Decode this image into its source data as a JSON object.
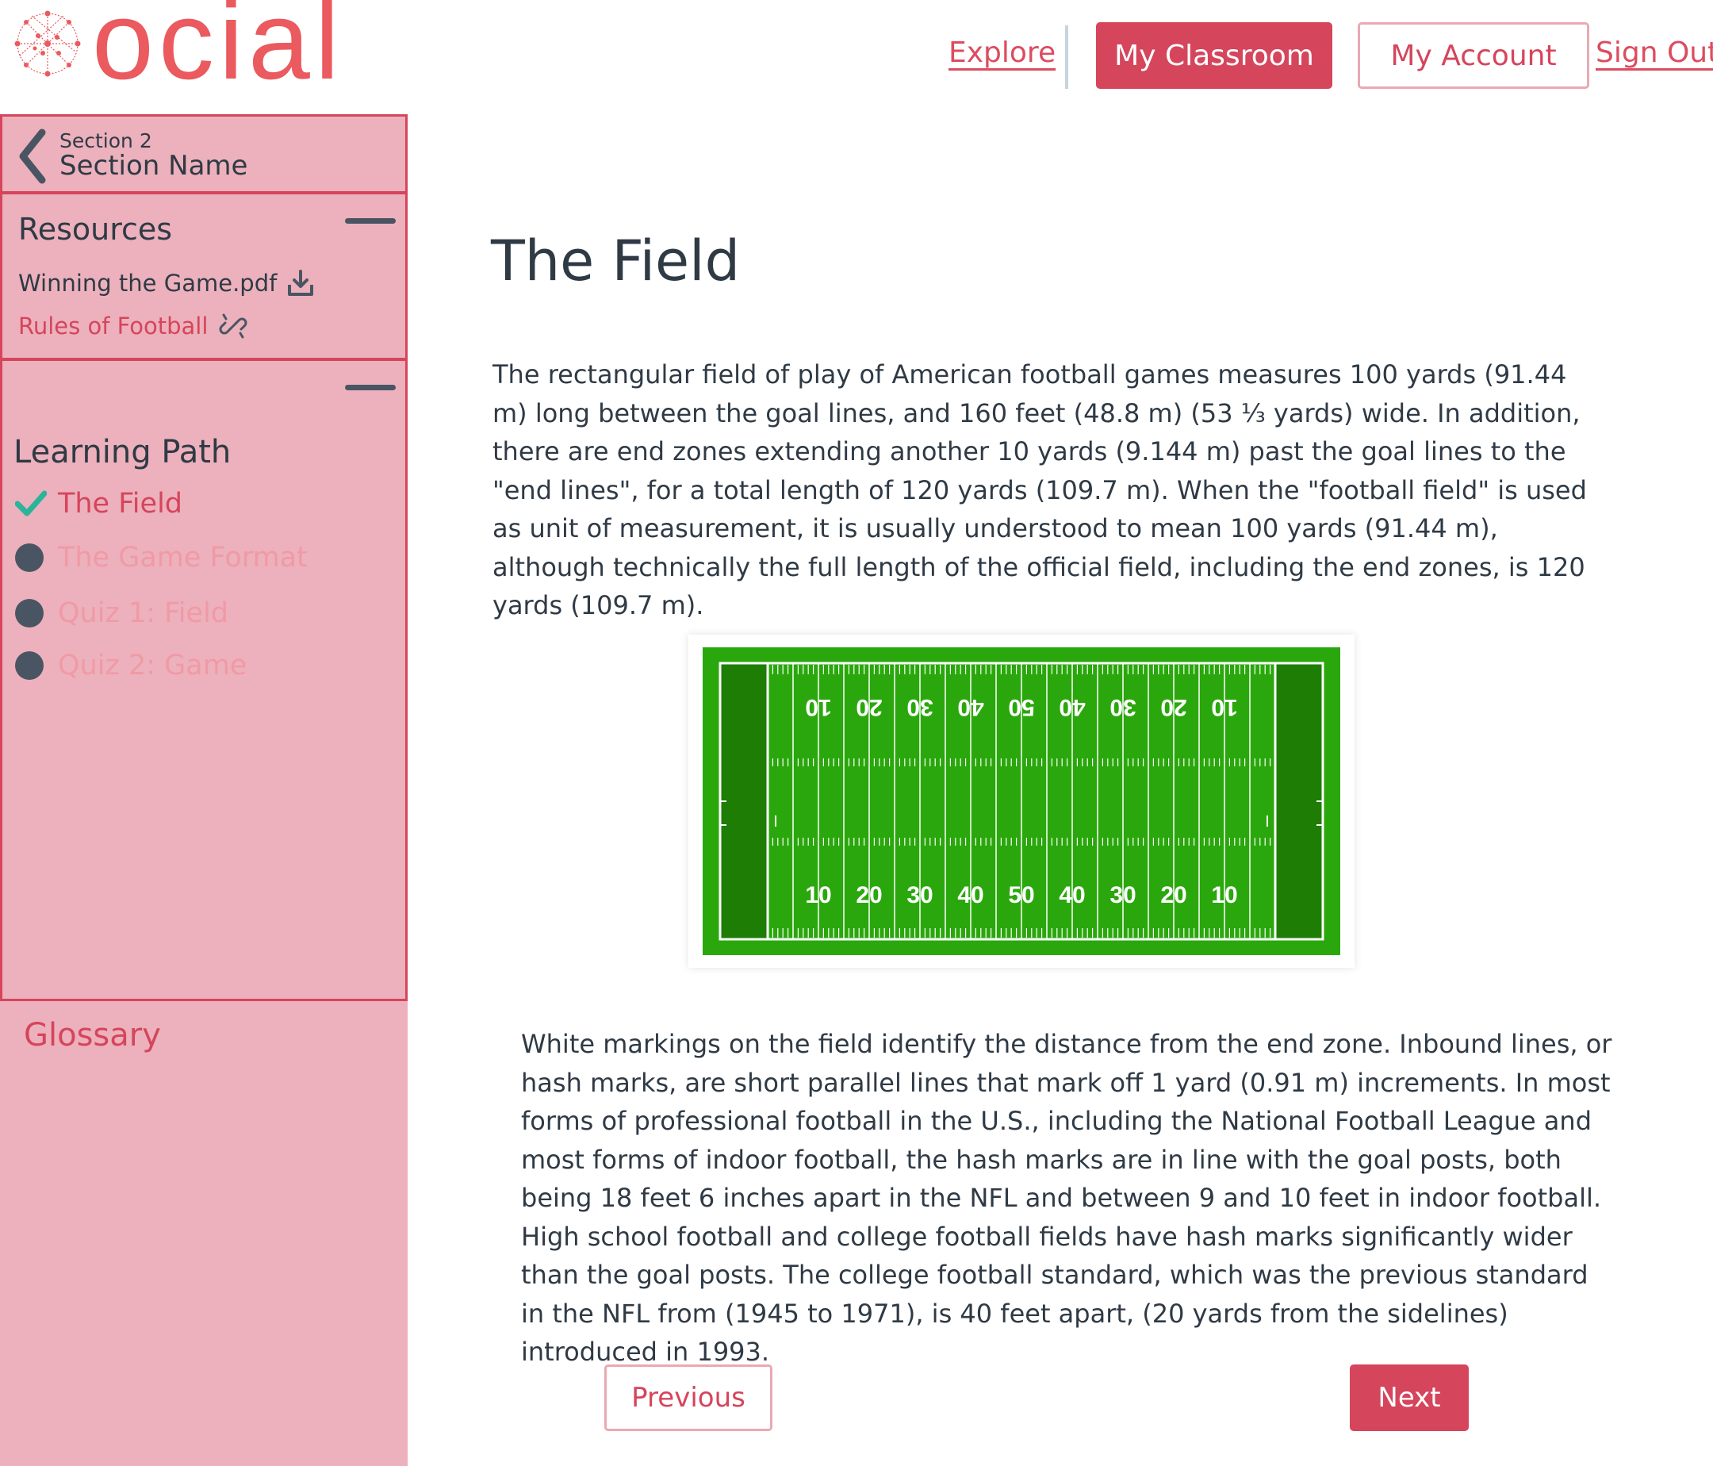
{
  "header": {
    "logo_text": "ocial",
    "nav": {
      "explore": "Explore",
      "my_classroom": "My Classroom",
      "my_account": "My Account",
      "sign_out": "Sign Out"
    }
  },
  "sidebar": {
    "section_label": "Section 2",
    "section_name": "Section Name",
    "resources": {
      "title": "Resources",
      "items": [
        {
          "label": "Winning the Game.pdf",
          "icon": "download-icon"
        },
        {
          "label": "Rules of Football",
          "icon": "link-icon"
        }
      ]
    },
    "learning_path": {
      "title": "Learning Path",
      "items": [
        {
          "label": "The Field",
          "status": "complete"
        },
        {
          "label": "The Game Format",
          "status": "pending"
        },
        {
          "label": "Quiz 1: Field",
          "status": "pending"
        },
        {
          "label": "Quiz 2: Game",
          "status": "pending"
        }
      ]
    },
    "glossary": "Glossary"
  },
  "main": {
    "title": "The Field",
    "paragraph1": "The rectangular field of play of American football games measures 100 yards (91.44 m) long between the goal lines, and 160 feet (48.8 m) (53 ⅓ yards) wide. In addition, there are end zones extending another 10 yards (9.144 m) past the goal lines to the \"end lines\", for a total length of 120 yards (109.7 m). When the \"football field\" is used as unit of measurement, it is usually understood to mean 100 yards (91.44 m), although technically the full length of the official field, including the end zones, is 120 yards (109.7 m).",
    "field_numbers": [
      "10",
      "20",
      "30",
      "40",
      "50",
      "40",
      "30",
      "20",
      "10"
    ],
    "paragraph2": "White markings on the field identify the distance from the end zone. Inbound lines, or hash marks, are short parallel lines that mark off 1 yard (0.91 m) increments. In most forms of professional football in the U.S., including the National Football League and most forms of indoor football, the hash marks are in line with the goal posts, both being 18 feet 6 inches apart in the NFL and between 9 and 10 feet in indoor football. High school football and college football fields have hash marks significantly wider than the goal posts. The college football standard, which was the previous standard in the NFL from (1945 to 1971), is 40 feet apart, (20 yards from the sidelines) introduced in 1993.",
    "previous_label": "Previous",
    "next_label": "Next"
  },
  "colors": {
    "accent": "#d5455c",
    "sidebar_bg": "#ecb1bc",
    "field_green": "#2aa70c",
    "endzone_green": "#1e7d05",
    "check_teal": "#2ab49a"
  }
}
